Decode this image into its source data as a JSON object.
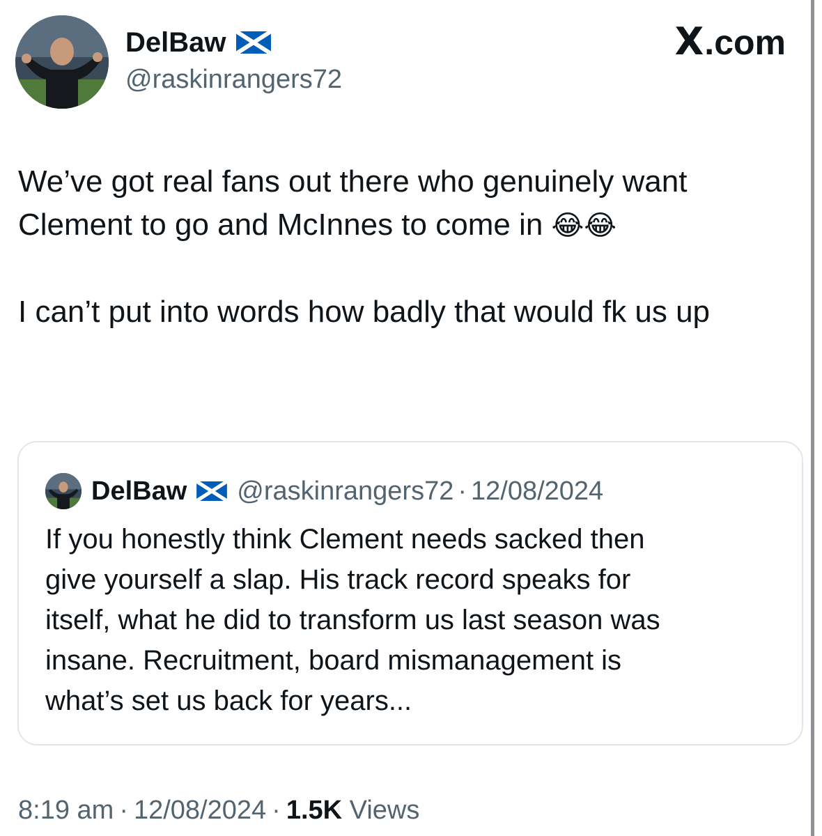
{
  "author": {
    "display_name": "DelBaw",
    "handle": "@raskinrangers72",
    "flag_icon": "scotland-flag"
  },
  "brand": {
    "mark": "X",
    "suffix": ".com"
  },
  "tweet": {
    "paragraphs": [
      {
        "text": "We’ve got real fans out there who genuinely want Clement to go and McInnes to come in ",
        "emoji": "😂😂"
      },
      {
        "text": "I can’t put into words how badly that would fk us up",
        "emoji": ""
      }
    ]
  },
  "quoted_tweet": {
    "display_name": "DelBaw",
    "handle": "@raskinrangers72",
    "separator": "·",
    "date": "12/08/2024",
    "text_lines": [
      "If you honestly think Clement needs sacked then",
      "give yourself a slap. His track record speaks for",
      "itself, what he did to transform us last season was",
      "insane. Recruitment, board mismanagement is",
      "what’s set us back for years..."
    ]
  },
  "meta": {
    "time": "8:19 am",
    "separator": "·",
    "date": "12/08/2024",
    "views_count": "1.5K",
    "views_label": "Views"
  },
  "colors": {
    "text_primary": "#0f1419",
    "text_secondary": "#536471",
    "card_border": "#e3e6e8",
    "scotland_blue": "#005eb8"
  }
}
